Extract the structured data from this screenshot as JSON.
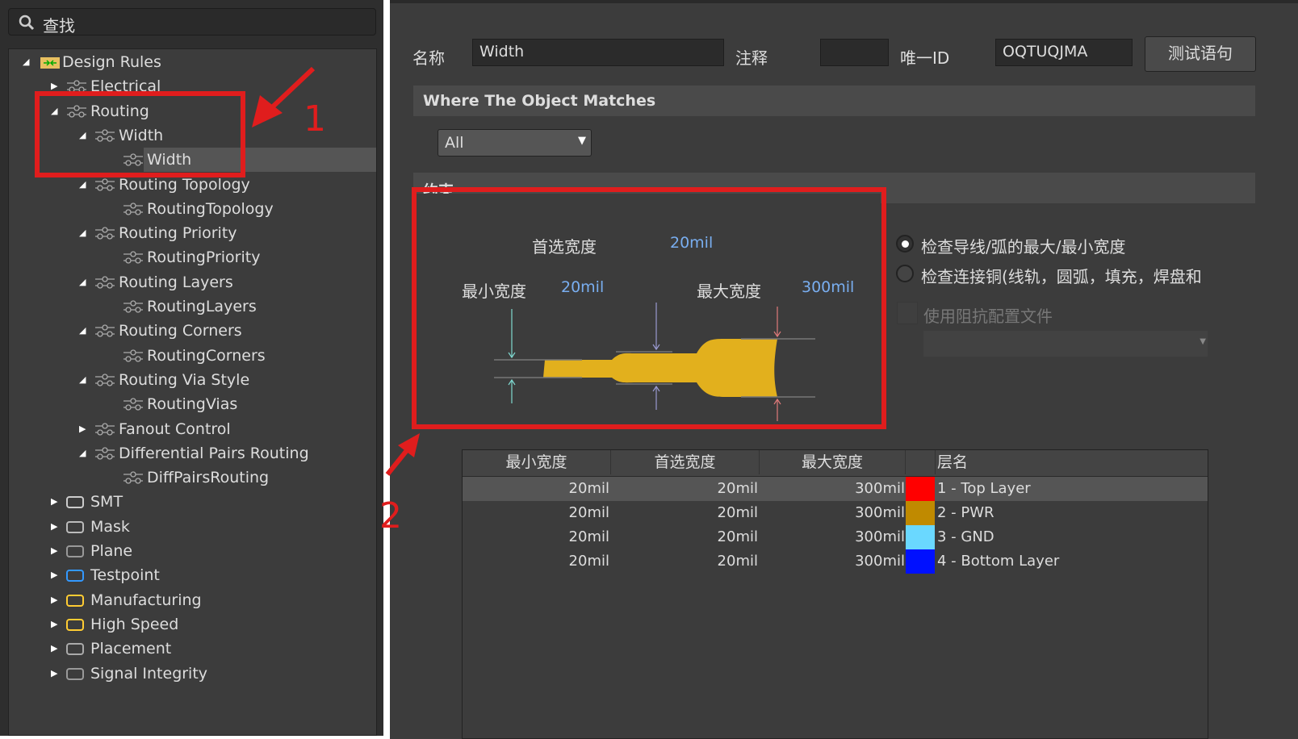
{
  "search": {
    "placeholder": "查找",
    "icon": "search-icon"
  },
  "tree": [
    {
      "label": "Design Rules",
      "level": 0,
      "arrow": "expanded",
      "icon": "folder-rules-icon"
    },
    {
      "label": "Electrical",
      "level": 1,
      "arrow": "collapsed",
      "icon": "electrical-icon"
    },
    {
      "label": "Routing",
      "level": 1,
      "arrow": "expanded",
      "icon": "rule-icon"
    },
    {
      "label": "Width",
      "level": 2,
      "arrow": "expanded",
      "icon": "rule-icon"
    },
    {
      "label": "Width",
      "level": 3,
      "arrow": "",
      "icon": "rule-icon",
      "selected": true
    },
    {
      "label": "Routing Topology",
      "level": 2,
      "arrow": "expanded",
      "icon": "rule-icon"
    },
    {
      "label": "RoutingTopology",
      "level": 3,
      "arrow": "",
      "icon": "rule-icon"
    },
    {
      "label": "Routing Priority",
      "level": 2,
      "arrow": "expanded",
      "icon": "rule-icon"
    },
    {
      "label": "RoutingPriority",
      "level": 3,
      "arrow": "",
      "icon": "rule-icon"
    },
    {
      "label": "Routing Layers",
      "level": 2,
      "arrow": "expanded",
      "icon": "rule-icon"
    },
    {
      "label": "RoutingLayers",
      "level": 3,
      "arrow": "",
      "icon": "rule-icon"
    },
    {
      "label": "Routing Corners",
      "level": 2,
      "arrow": "expanded",
      "icon": "rule-icon"
    },
    {
      "label": "RoutingCorners",
      "level": 3,
      "arrow": "",
      "icon": "rule-icon"
    },
    {
      "label": "Routing Via Style",
      "level": 2,
      "arrow": "expanded",
      "icon": "rule-icon"
    },
    {
      "label": "RoutingVias",
      "level": 3,
      "arrow": "",
      "icon": "rule-icon"
    },
    {
      "label": "Fanout Control",
      "level": 2,
      "arrow": "collapsed",
      "icon": "rule-icon"
    },
    {
      "label": "Differential Pairs Routing",
      "level": 2,
      "arrow": "expanded",
      "icon": "rule-icon"
    },
    {
      "label": "DiffPairsRouting",
      "level": 3,
      "arrow": "",
      "icon": "rule-icon"
    },
    {
      "label": "SMT",
      "level": 1,
      "arrow": "collapsed",
      "icon": "smt-icon"
    },
    {
      "label": "Mask",
      "level": 1,
      "arrow": "collapsed",
      "icon": "mask-icon"
    },
    {
      "label": "Plane",
      "level": 1,
      "arrow": "collapsed",
      "icon": "plane-icon"
    },
    {
      "label": "Testpoint",
      "level": 1,
      "arrow": "collapsed",
      "icon": "testpoint-icon"
    },
    {
      "label": "Manufacturing",
      "level": 1,
      "arrow": "collapsed",
      "icon": "manufacturing-icon"
    },
    {
      "label": "High Speed",
      "level": 1,
      "arrow": "collapsed",
      "icon": "high-speed-icon"
    },
    {
      "label": "Placement",
      "level": 1,
      "arrow": "collapsed",
      "icon": "placement-icon"
    },
    {
      "label": "Signal Integrity",
      "level": 1,
      "arrow": "collapsed",
      "icon": "signal-integrity-icon"
    }
  ],
  "header": {
    "name_label": "名称",
    "name_value": "Width",
    "comment_label": "注释",
    "comment_value": "",
    "id_label": "唯一ID",
    "id_value": "OQTUQJMA",
    "test_button": "测试语句"
  },
  "where": {
    "title": "Where The Object Matches",
    "select_value": "All"
  },
  "constraints": {
    "title": "约束",
    "preferred_label": "首选宽度",
    "preferred_value": "20mil",
    "min_label": "最小宽度",
    "min_value": "20mil",
    "max_label": "最大宽度",
    "max_value": "300mil"
  },
  "options": {
    "radio1": "检查导线/弧的最大/最小宽度",
    "radio2": "检查连接铜(线轨，圆弧，填充，焊盘和",
    "radio1_checked": true,
    "checkbox": "使用阻抗配置文件",
    "checkbox_checked": false
  },
  "table": {
    "headers": [
      "最小宽度",
      "首选宽度",
      "最大宽度",
      "",
      "层名"
    ],
    "rows": [
      {
        "min": "20mil",
        "pref": "20mil",
        "max": "300mil",
        "color": "#ff0000",
        "layer": "1 - Top Layer"
      },
      {
        "min": "20mil",
        "pref": "20mil",
        "max": "300mil",
        "color": "#c08a00",
        "layer": "2 - PWR"
      },
      {
        "min": "20mil",
        "pref": "20mil",
        "max": "300mil",
        "color": "#6ad8ff",
        "layer": "3 - GND"
      },
      {
        "min": "20mil",
        "pref": "20mil",
        "max": "300mil",
        "color": "#0010ff",
        "layer": "4 - Bottom Layer"
      }
    ]
  },
  "annotations": {
    "label1": "1",
    "label2": "2",
    "color": "#e01d1d"
  }
}
